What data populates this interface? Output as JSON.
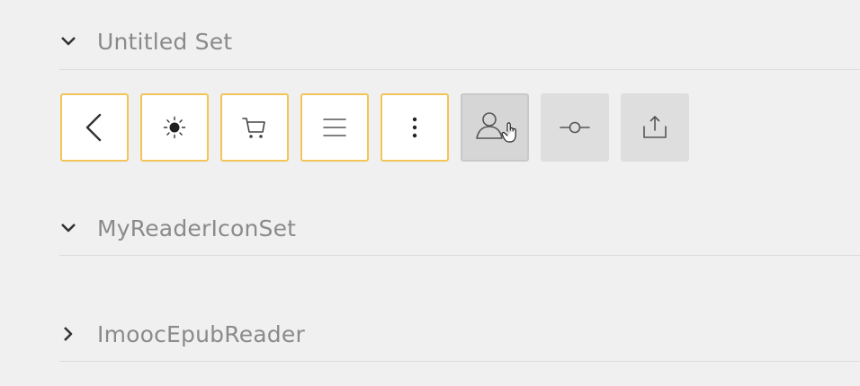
{
  "sets": [
    {
      "title": "Untitled Set",
      "expanded": true,
      "icon": "chevron-down-icon"
    },
    {
      "title": "MyReaderIconSet",
      "expanded": true,
      "icon": "chevron-down-icon"
    },
    {
      "title": "ImoocEpubReader",
      "expanded": false,
      "icon": "chevron-right-icon"
    }
  ],
  "icons": [
    {
      "name": "chevron-left-icon",
      "state": "selected"
    },
    {
      "name": "brightness-icon",
      "state": "selected"
    },
    {
      "name": "shopping-cart-icon",
      "state": "selected"
    },
    {
      "name": "menu-icon",
      "state": "selected"
    },
    {
      "name": "more-vertical-icon",
      "state": "selected"
    },
    {
      "name": "user-icon",
      "state": "hover"
    },
    {
      "name": "commit-icon",
      "state": "normal"
    },
    {
      "name": "share-upload-icon",
      "state": "normal"
    }
  ],
  "colors": {
    "selected_border": "#f2c45a",
    "tile_normal": "#dedede",
    "text": "#8a8a8a",
    "icon_stroke": "#555555"
  }
}
